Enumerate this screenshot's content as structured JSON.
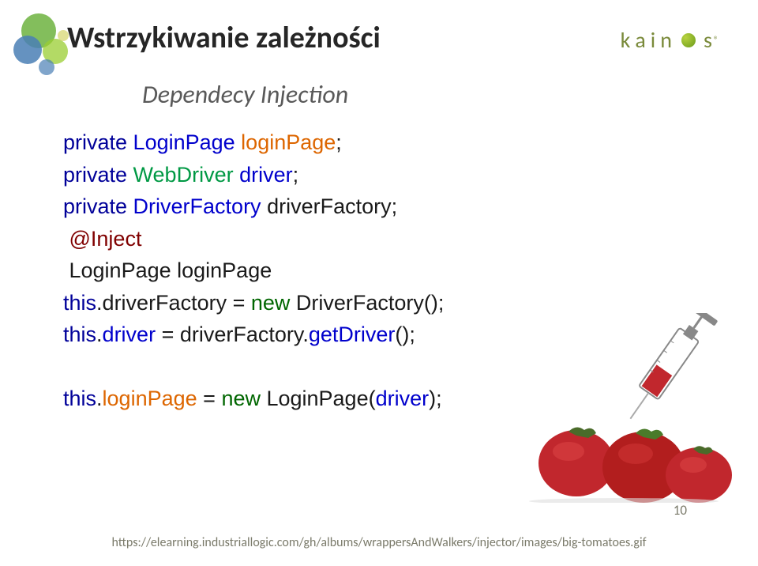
{
  "header": {
    "title": "Wstrzykiwanie zależności",
    "logo": {
      "letters": [
        "k",
        "a",
        "i",
        "n",
        "s"
      ],
      "registered": "®"
    }
  },
  "subtitle": "Dependecy Injection",
  "code": {
    "line1_kw": "private",
    "line1_type": " LoginPage",
    "line1_var": " loginPage",
    "line1_semi": ";",
    "line2_kw": "private",
    "line2_type": " WebDriver",
    "line2_var": " driver",
    "line2_semi": ";",
    "line3_kw": "private",
    "line3_type": " DriverFactory",
    "line3_var": " driverFactory",
    "line3_semi": ";",
    "line4_anno": " @Inject",
    "line5_type": " LoginPage",
    "line5_var": " loginPage",
    "line6_this": "this",
    "line6_dot1": ".",
    "line6_prop": "driverFactory",
    "line6_eq": " = ",
    "line6_new": "new",
    "line6_ctor": " DriverFactory",
    "line6_paren": "();",
    "line7_this": "this",
    "line7_dot1": ".",
    "line7_prop": "driver",
    "line7_eq": " = ",
    "line7_fac": "driverFactory",
    "line7_dot2": ".",
    "line7_method": "getDriver",
    "line7_paren": "();",
    "line8_this": "this",
    "line8_dot1": ".",
    "line8_prop": "loginPage",
    "line8_eq": " = ",
    "line8_new": "new",
    "line8_ctor": " LoginPage",
    "line8_paren_open": "(",
    "line8_arg": "driver",
    "line8_paren_close": ");"
  },
  "footer": {
    "page_number": "10",
    "url": "https://elearning.industriallogic.com/gh/albums/wrappersAndWalkers/injector/images/big-tomatoes.gif"
  }
}
